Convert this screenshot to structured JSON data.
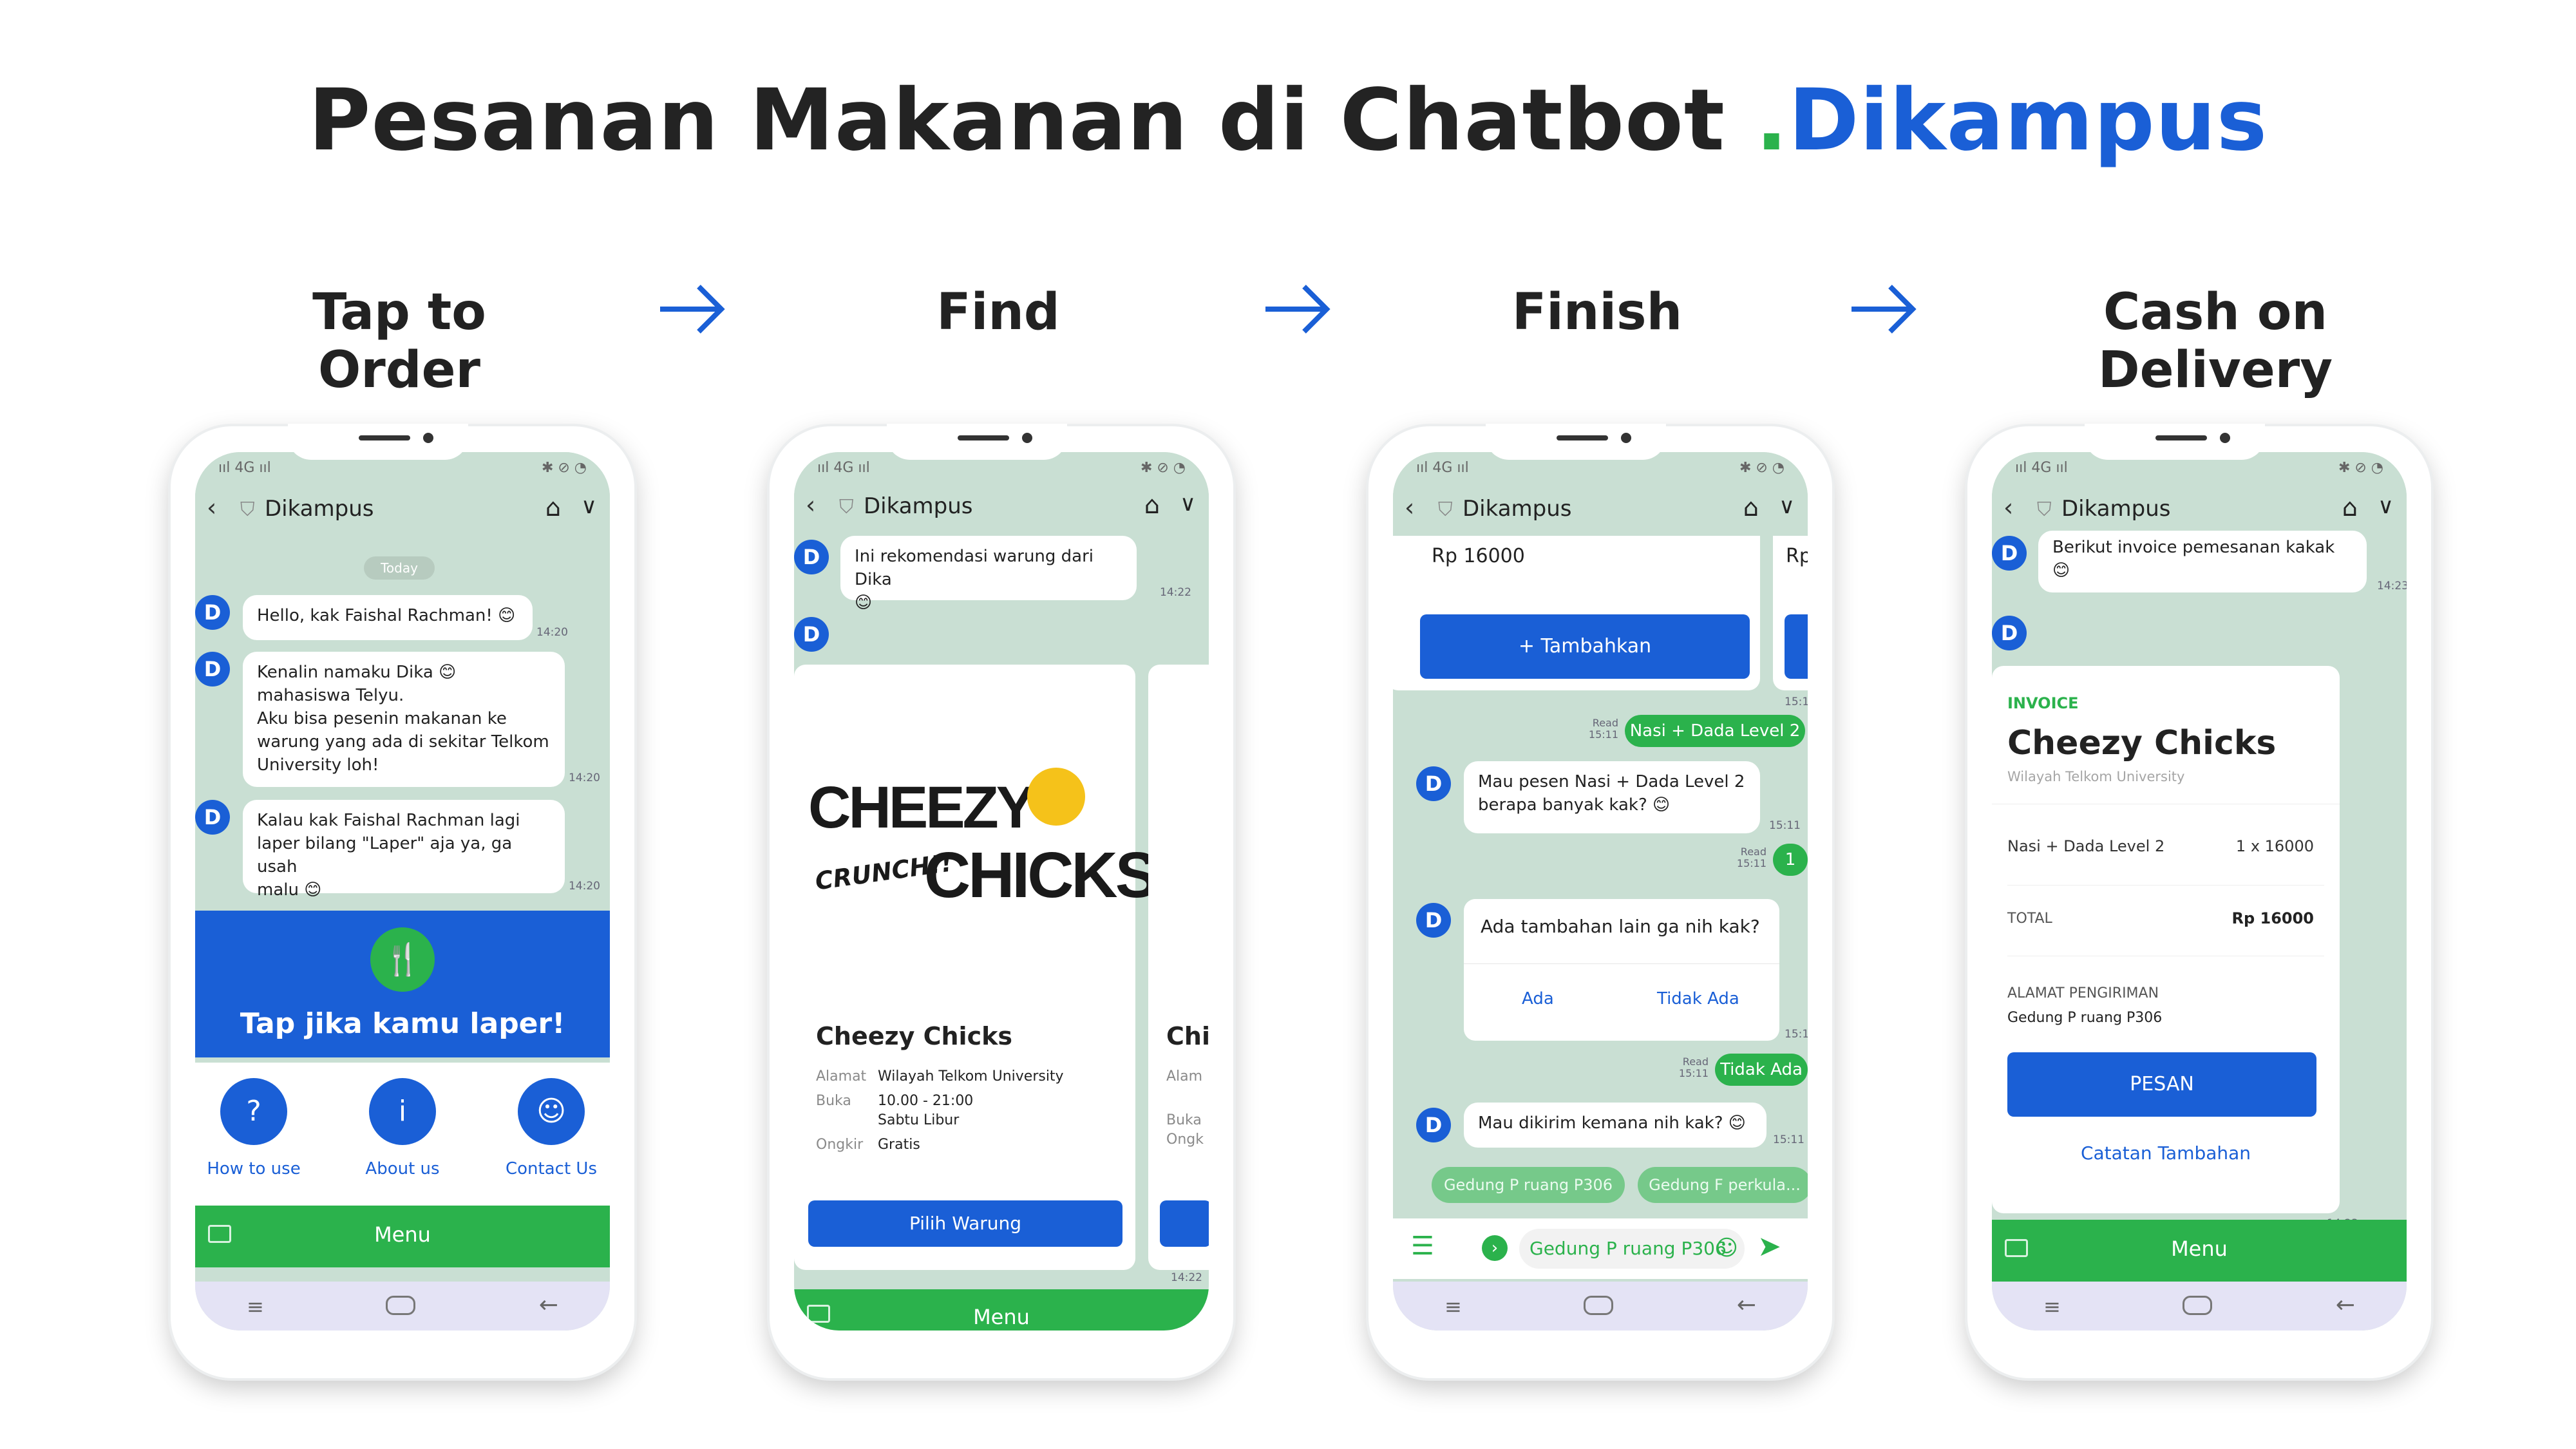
{
  "title": {
    "part1": "Pesanan Makanan di Chatbot ",
    "dot": ".",
    "brand": "Dikampus"
  },
  "steps": [
    "Tap to Order",
    "Find",
    "Finish",
    "Cash on Delivery"
  ],
  "common": {
    "chat_name": "Dikampus",
    "avatar_letter": "D",
    "status_left": "ııl 4G ııl",
    "status_right": "✱ ⊘ ◔",
    "menu_label": "Menu"
  },
  "phone1": {
    "today": "Today",
    "msg1": "Hello, kak Faishal Rachman! 😊",
    "time1": "14:20",
    "msg2_lines": [
      "Kenalin namaku Dika 😊",
      "mahasiswa Telyu.",
      "Aku bisa pesenin makanan ke",
      "warung yang ada di sekitar Telkom",
      "University loh!"
    ],
    "time2": "14:20",
    "msg3_lines": [
      "Kalau kak Faishal Rachman lagi",
      "laper bilang \"Laper\" aja ya, ga usah",
      "malu 😊"
    ],
    "time3": "14:20",
    "cta": "Tap jika kamu laper!",
    "shortcuts": [
      {
        "label": "How to use",
        "icon": "?"
      },
      {
        "label": "About us",
        "icon": "i"
      },
      {
        "label": "Contact Us",
        "icon": "☺"
      }
    ]
  },
  "phone2": {
    "msg1": "Ini rekomendasi warung dari Dika",
    "msg1_emoji": "😊",
    "time1": "14:22",
    "logo_line1": "CHEEZY",
    "logo_line2": "CRUNCH!!",
    "logo_line3": "CHICKS",
    "card_title": "Cheezy Chicks",
    "fields": [
      {
        "label": "Alamat",
        "value": "Wilayah Telkom University"
      },
      {
        "label": "Buka",
        "value": "10.00 - 21:00"
      },
      {
        "label": "",
        "value": "Sabtu Libur"
      },
      {
        "label": "Ongkir",
        "value": "Gratis"
      }
    ],
    "button": "Pilih Warung",
    "next_card_title": "Chi",
    "next_fields": [
      "Alam",
      "Buka",
      "Ongk"
    ],
    "time2": "14:22"
  },
  "phone3": {
    "price": "Rp 16000",
    "price_next": "Rp",
    "add_button": "+ Tambahkan",
    "time_a": "15:1",
    "read1": "Read\n15:11",
    "user_msg1": "Nasi + Dada Level 2",
    "bot_q1_lines": [
      "Mau pesen Nasi + Dada Level 2",
      "berapa banyak kak? 😊"
    ],
    "time_q1": "15:11",
    "read2": "Read\n15:11",
    "user_qty": "1",
    "bot_q2": "Ada tambahan lain ga nih kak?",
    "opt_yes": "Ada",
    "opt_no": "Tidak Ada",
    "time_q2": "15:11",
    "read3": "Read\n15:11",
    "user_msg2": "Tidak Ada",
    "bot_q3": "Mau dikirim kemana nih kak? 😊",
    "time_q3": "15:11",
    "suggestions": [
      "Gedung P ruang P306",
      "Gedung F perkula..."
    ],
    "input_value": "Gedung P ruang P306"
  },
  "phone4": {
    "msg1": "Berikut invoice pemesanan kakak",
    "msg1_emoji": "😊",
    "time1": "14:23",
    "invoice_label": "INVOICE",
    "store": "Cheezy Chicks",
    "store_sub": "Wilayah Telkom University",
    "item": "Nasi + Dada Level 2",
    "qty": "1 x 16000",
    "total_label": "TOTAL",
    "total_value": "Rp 16000",
    "address_label": "ALAMAT PENGIRIMAN",
    "address": "Gedung P ruang P306",
    "button": "PESAN",
    "note_link": "Catatan Tambahan",
    "time2": "14:23"
  },
  "colors": {
    "brand_blue": "#1a5fd6",
    "brand_green": "#2bb24c",
    "chat_bg": "#c9dfd3"
  }
}
